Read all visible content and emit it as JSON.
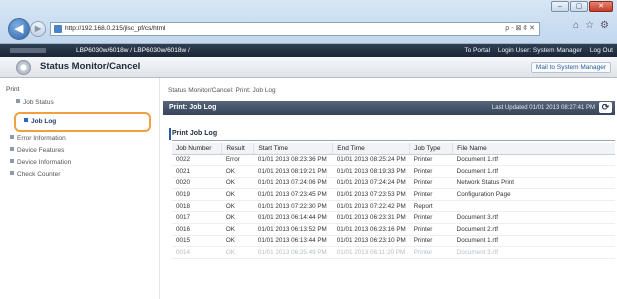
{
  "browser": {
    "address": "http://192.168.0.215/jlsc_pf/cs/html",
    "address_tools": "ρ - ⊠ ¢ ✕",
    "window_buttons": [
      "–",
      "▢",
      "✕"
    ],
    "toolbar_icons": [
      "home-icon",
      "star-icon",
      "gear-icon"
    ]
  },
  "header": {
    "device": "LBP6030w/6018w / LBP6030w/6018w /",
    "to_portal": "To Portal",
    "login_user": "Login User: System Manager",
    "log_out": "Log Out"
  },
  "app": {
    "title": "Status Monitor/Cancel",
    "mail_button": "Mail to System Manager"
  },
  "sidebar": {
    "section": "Print",
    "items": [
      {
        "label": "Job Status"
      },
      {
        "label": "Job Log"
      },
      {
        "label": "Error Information"
      },
      {
        "label": "Device Features"
      },
      {
        "label": "Device Information"
      },
      {
        "label": "Check Counter"
      }
    ]
  },
  "breadcrumb": "Status Monitor/Cancel: Print: Job Log",
  "panel": {
    "title": "Print: Job Log",
    "last_updated": "Last Updated 01/01 2013 08:27:41 PM"
  },
  "section_title": "Print Job Log",
  "table": {
    "headers": [
      "Job Number",
      "Result",
      "Start Time",
      "End Time",
      "Job Type",
      "File Name"
    ],
    "rows": [
      [
        "0022",
        "Error",
        "01/01 2013 08:23:36 PM",
        "01/01 2013 08:25:24 PM",
        "Printer",
        "Document 1.rtf"
      ],
      [
        "0021",
        "OK",
        "01/01 2013 08:19:21 PM",
        "01/01 2013 08:19:33 PM",
        "Printer",
        "Document 1.rtf"
      ],
      [
        "0020",
        "OK",
        "01/01 2013 07:24:06 PM",
        "01/01 2013 07:24:24 PM",
        "Printer",
        "Network Status Print"
      ],
      [
        "0019",
        "OK",
        "01/01 2013 07:23:45 PM",
        "01/01 2013 07:23:53 PM",
        "Printer",
        "Configuration Page"
      ],
      [
        "0018",
        "OK",
        "01/01 2013 07:22:30 PM",
        "01/01 2013 07:22:42 PM",
        "Report",
        ""
      ],
      [
        "0017",
        "OK",
        "01/01 2013 06:14:44 PM",
        "01/01 2013 06:23:31 PM",
        "Printer",
        "Document 3.rtf"
      ],
      [
        "0016",
        "OK",
        "01/01 2013 06:13:52 PM",
        "01/01 2013 06:23:16 PM",
        "Printer",
        "Document 2.rtf"
      ],
      [
        "0015",
        "OK",
        "01/01 2013 06:13:44 PM",
        "01/01 2013 06:23:10 PM",
        "Printer",
        "Document 1.rtf"
      ],
      [
        "0014",
        "OK",
        "01/01 2013 06:25:49 PM",
        "01/01 2013 06:11:20 PM",
        "Printer",
        "Document 3.rtf"
      ]
    ]
  },
  "colors": {
    "highlight": "#f0a040",
    "header_dark": "#1b2637",
    "panel_head": "#3f4e63",
    "link": "#2a5d9c"
  }
}
